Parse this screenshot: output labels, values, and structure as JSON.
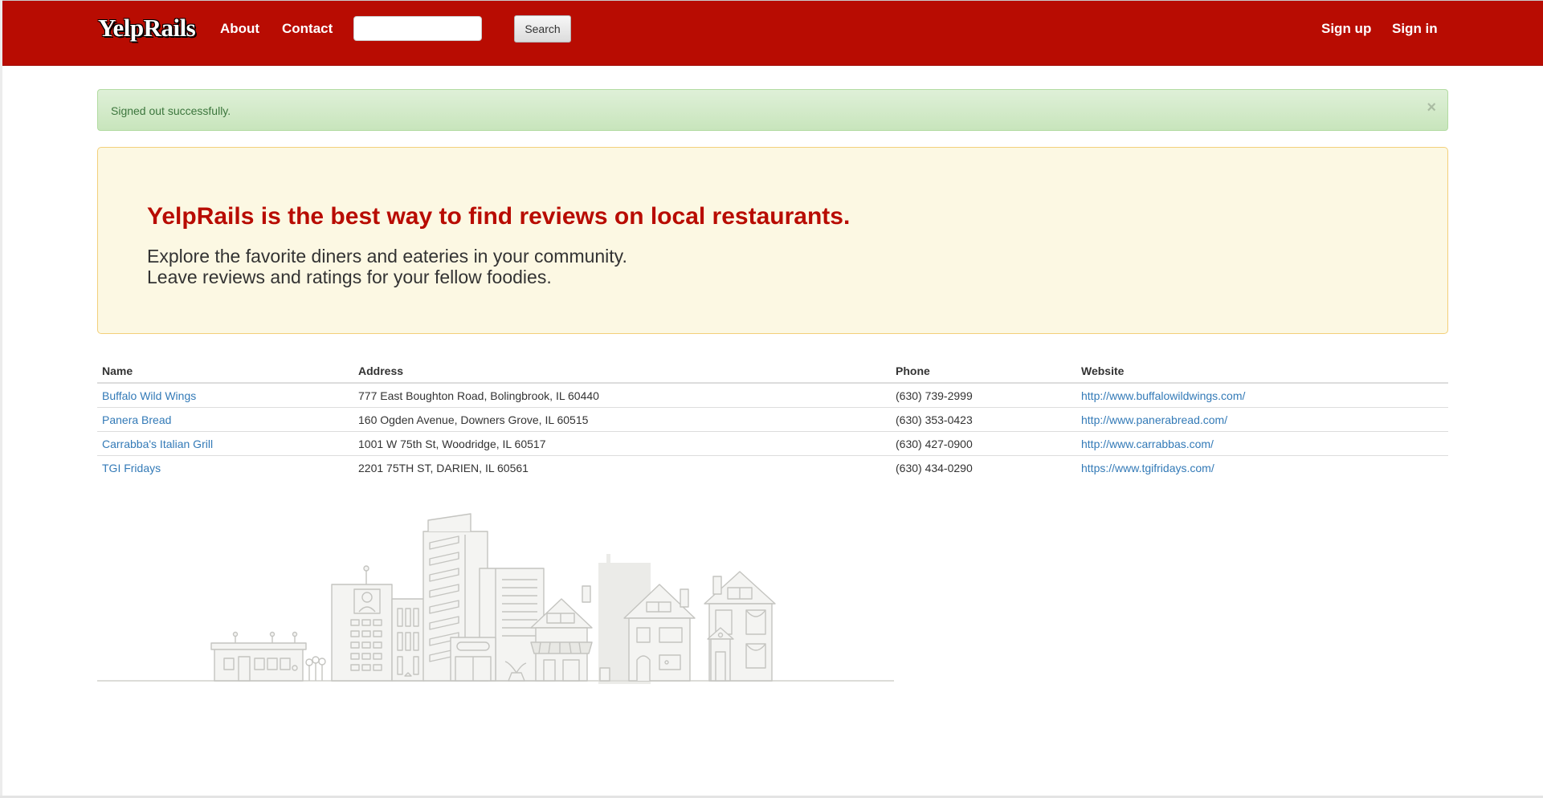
{
  "navbar": {
    "brand": "YelpRails",
    "links": [
      {
        "label": "About"
      },
      {
        "label": "Contact"
      }
    ],
    "search": {
      "value": "",
      "placeholder": "",
      "button_label": "Search"
    },
    "auth": [
      {
        "label": "Sign up"
      },
      {
        "label": "Sign in"
      }
    ]
  },
  "flash": {
    "message": "Signed out successfully.",
    "close_symbol": "×"
  },
  "hero": {
    "title": "YelpRails is the best way to find reviews on local restaurants.",
    "lines": [
      "Explore the favorite diners and eateries in your community.",
      "Leave reviews and ratings for your fellow foodies."
    ]
  },
  "restaurants": {
    "columns": [
      "Name",
      "Address",
      "Phone",
      "Website"
    ],
    "rows": [
      {
        "name": "Buffalo Wild Wings",
        "address": "777 East Boughton Road, Bolingbrook, IL 60440",
        "phone": "(630) 739-2999",
        "website": "http://www.buffalowildwings.com/"
      },
      {
        "name": "Panera Bread",
        "address": "160 Ogden Avenue, Downers Grove, IL 60515",
        "phone": "(630) 353-0423",
        "website": "http://www.panerabread.com/"
      },
      {
        "name": "Carrabba's Italian Grill",
        "address": "1001 W 75th St, Woodridge, IL 60517",
        "phone": "(630) 427-0900",
        "website": "http://www.carrabbas.com/"
      },
      {
        "name": "TGI Fridays",
        "address": "2201 75TH ST, DARIEN, IL 60561",
        "phone": "(630) 434-0290",
        "website": "https://www.tgifridays.com/"
      }
    ]
  },
  "colors": {
    "navbar": "#b80c02",
    "hero_title": "#b80c02",
    "hero_bg": "#fcf8e3",
    "alert_bg": "#dff0d8",
    "alert_text": "#3c763d",
    "link": "#337ab7"
  },
  "icons": {
    "close": "close-icon",
    "illustration": "city-skyline-illustration"
  }
}
